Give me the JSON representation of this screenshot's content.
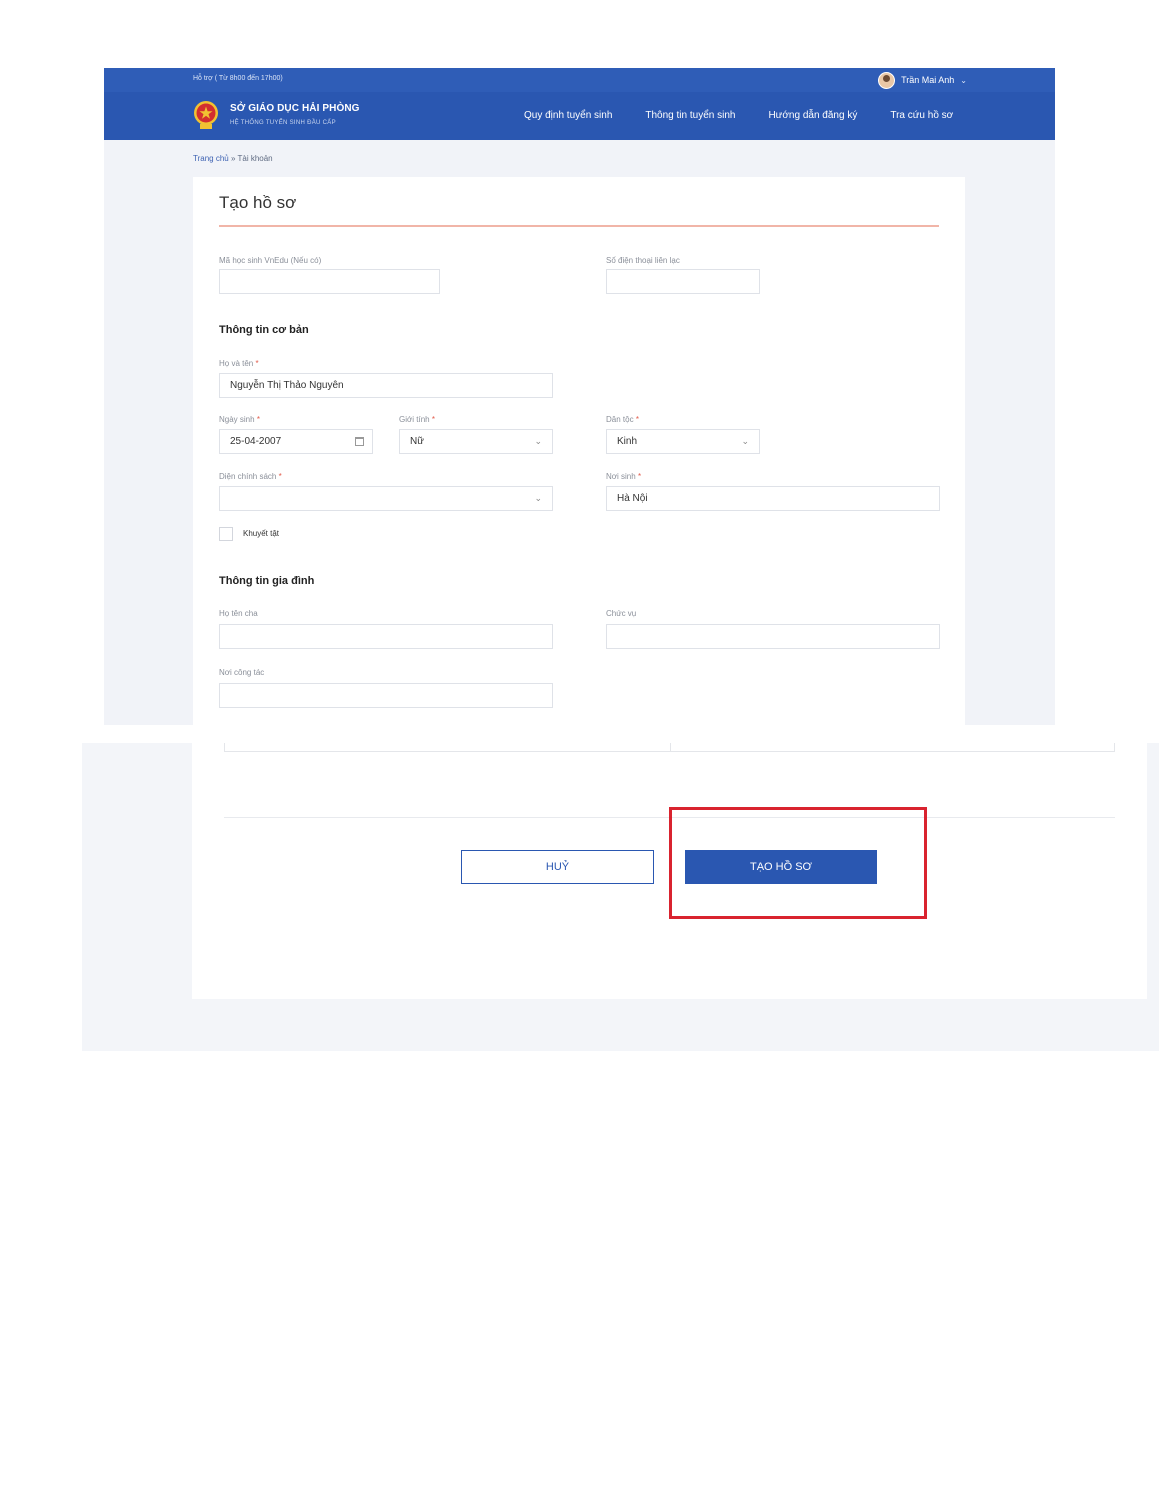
{
  "header": {
    "support_text": "Hỗ trợ ( Từ 8h00 đến 17h00)",
    "user_name": "Trần Mai Anh",
    "brand_title": "SỞ GIÁO DỤC HẢI PHÒNG",
    "brand_subtitle": "HỆ THỐNG TUYỂN SINH ĐẦU CẤP",
    "nav": [
      "Quy định tuyển sinh",
      "Thông tin tuyển sinh",
      "Hướng dẫn đăng ký",
      "Tra cứu hồ sơ"
    ]
  },
  "breadcrumb": {
    "home": "Trang chủ",
    "separator": "»",
    "current": "Tài khoản"
  },
  "form": {
    "title": "Tạo hồ sơ",
    "vnedu_label": "Mã học sinh VnEdu (Nếu có)",
    "vnedu_value": "",
    "phone_label": "Số điện thoại liên lạc",
    "phone_value": "",
    "basic_section": "Thông tin cơ bản",
    "fullname_label": "Họ và tên",
    "fullname_value": "Nguyễn Thị Thảo Nguyên",
    "dob_label": "Ngày sinh",
    "dob_value": "25-04-2007",
    "gender_label": "Giới tính",
    "gender_value": "Nữ",
    "ethnicity_label": "Dân tộc",
    "ethnicity_value": "Kinh",
    "policy_label": "Diện chính sách",
    "policy_value": "",
    "birthplace_label": "Nơi sinh",
    "birthplace_value": "Hà Nội",
    "disability_label": "Khuyết tật",
    "family_section": "Thông tin gia đình",
    "father_label": "Họ tên cha",
    "father_value": "",
    "position_label": "Chức vụ",
    "position_value": "",
    "workplace_label": "Nơi công tác",
    "workplace_value": "",
    "required_mark": "*"
  },
  "actions": {
    "cancel_label": "HUỶ",
    "create_label": "TẠO HỒ SƠ"
  },
  "colors": {
    "primary": "#2a57b1",
    "highlight": "#d9232f",
    "title_underline": "#f1b5a8"
  }
}
